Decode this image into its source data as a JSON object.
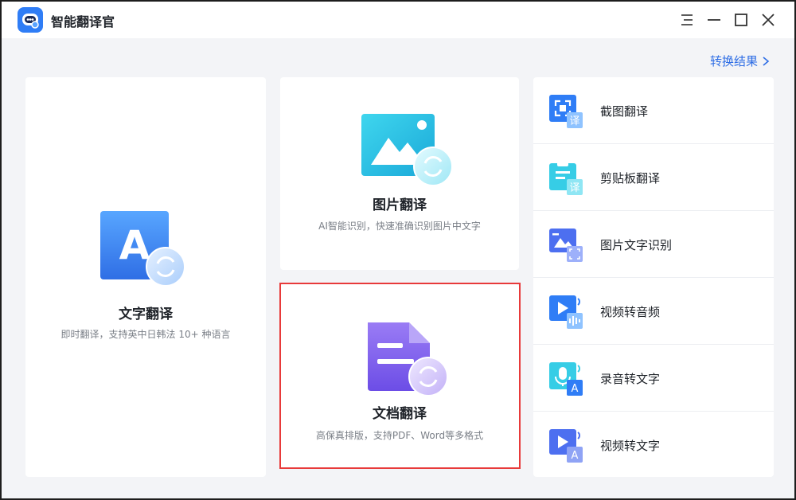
{
  "app": {
    "title": "智能翻译官"
  },
  "header": {
    "results_link": "转换结果"
  },
  "cards": {
    "text": {
      "title": "文字翻译",
      "desc": "即时翻译，支持英中日韩法 10+ 种语言",
      "icon_letter": "A"
    },
    "image": {
      "title": "图片翻译",
      "desc": "AI智能识别，快速准确识别图片中文字"
    },
    "doc": {
      "title": "文档翻译",
      "desc": "高保真排版，支持PDF、Word等多格式"
    }
  },
  "tools": [
    {
      "label": "截图翻译",
      "badge": "译"
    },
    {
      "label": "剪贴板翻译",
      "badge": "译"
    },
    {
      "label": "图片文字识别"
    },
    {
      "label": "视频转音频"
    },
    {
      "label": "录音转文字",
      "badge": "A"
    },
    {
      "label": "视频转文字",
      "badge": "A"
    }
  ],
  "colors": {
    "accent": "#2f6ee5",
    "highlight": "#e83a3a",
    "purple": "#7b5cf0"
  }
}
